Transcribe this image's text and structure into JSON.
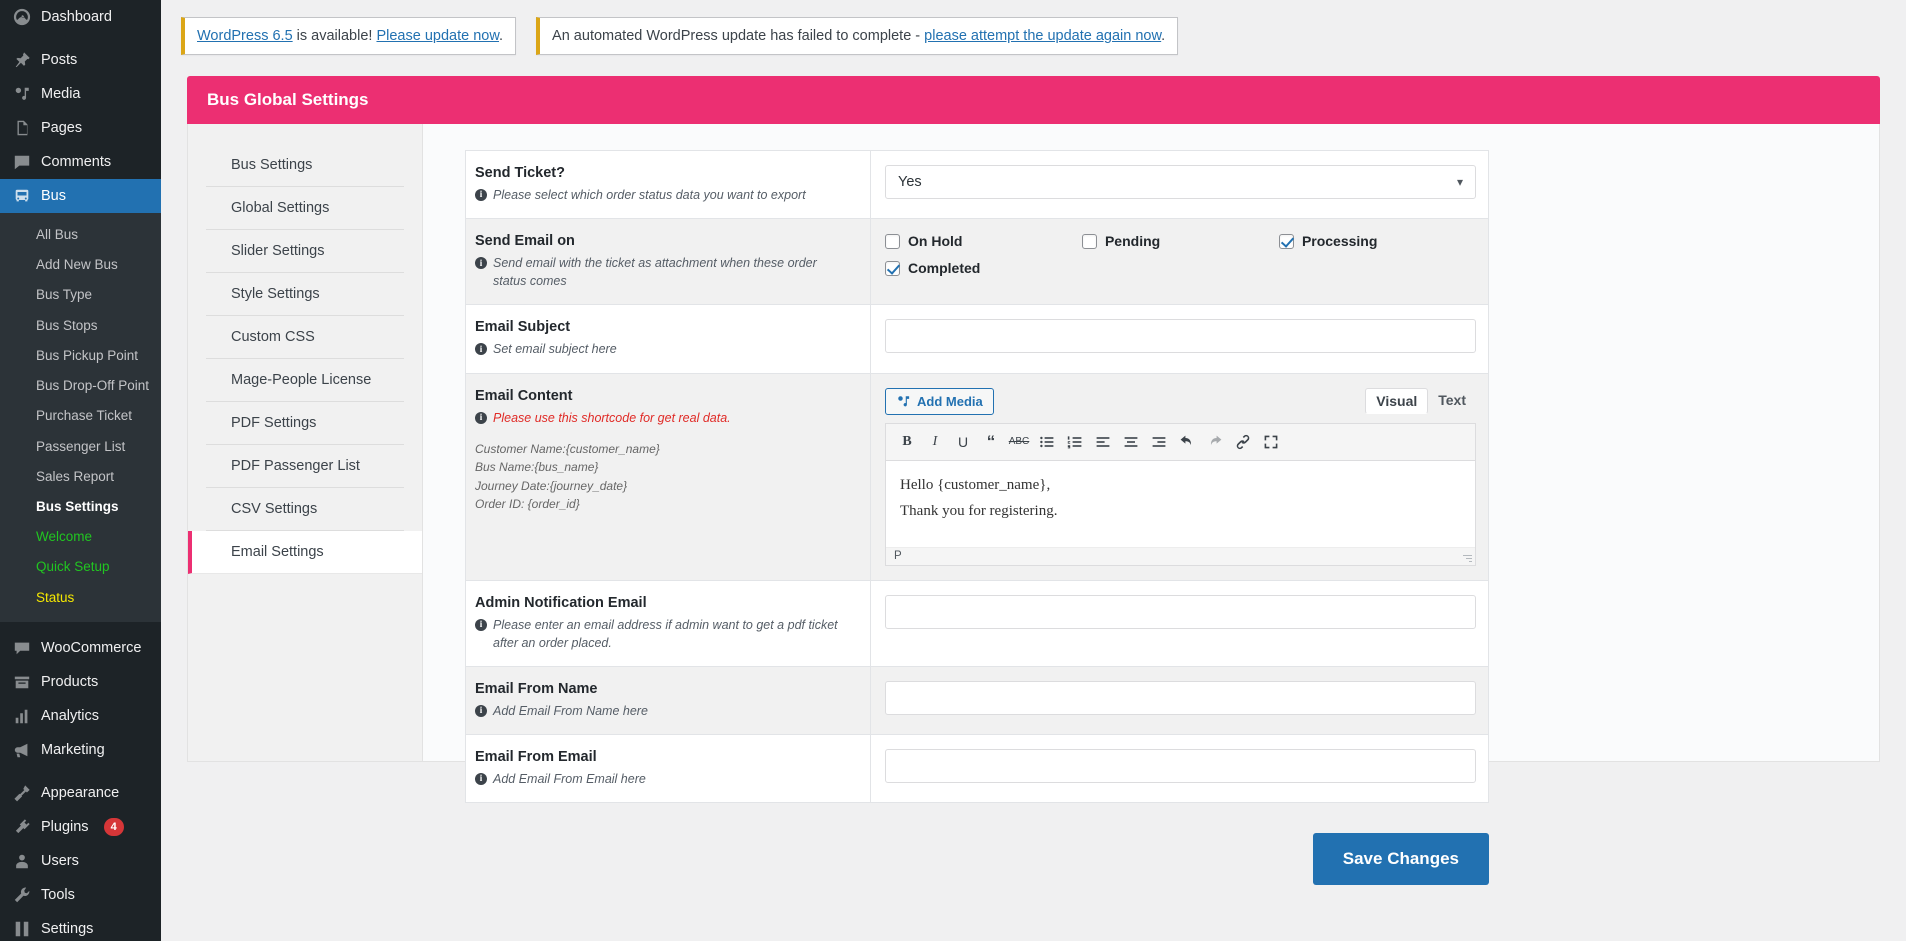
{
  "sidebar": {
    "top_items": [
      {
        "label": "Dashboard",
        "icon": "dashboard-icon"
      },
      {
        "label": "Posts",
        "icon": "pin-icon"
      },
      {
        "label": "Media",
        "icon": "media-icon"
      },
      {
        "label": "Pages",
        "icon": "pages-icon"
      },
      {
        "label": "Comments",
        "icon": "comments-icon"
      },
      {
        "label": "Bus",
        "icon": "bus-icon",
        "current": true
      }
    ],
    "bus_submenu": [
      {
        "label": "All Bus"
      },
      {
        "label": "Add New Bus"
      },
      {
        "label": "Bus Type"
      },
      {
        "label": "Bus Stops"
      },
      {
        "label": "Bus Pickup Point"
      },
      {
        "label": "Bus Drop-Off Point"
      },
      {
        "label": "Purchase Ticket"
      },
      {
        "label": "Passenger List"
      },
      {
        "label": "Sales Report"
      },
      {
        "label": "Bus Settings",
        "state": "current"
      },
      {
        "label": "Welcome",
        "state": "green"
      },
      {
        "label": "Quick Setup",
        "state": "green"
      },
      {
        "label": "Status",
        "state": "yellow"
      }
    ],
    "group2": [
      {
        "label": "WooCommerce",
        "icon": "woocommerce-icon"
      },
      {
        "label": "Products",
        "icon": "products-icon"
      },
      {
        "label": "Analytics",
        "icon": "analytics-icon"
      },
      {
        "label": "Marketing",
        "icon": "marketing-icon"
      }
    ],
    "group3": [
      {
        "label": "Appearance",
        "icon": "appearance-icon"
      },
      {
        "label": "Plugins",
        "icon": "plugins-icon",
        "badge": "4"
      },
      {
        "label": "Users",
        "icon": "users-icon"
      },
      {
        "label": "Tools",
        "icon": "tools-icon"
      },
      {
        "label": "Settings",
        "icon": "settings-icon"
      }
    ]
  },
  "notices": {
    "update": {
      "link1": "WordPress 6.5",
      "mid": " is available! ",
      "link2": "Please update now",
      "end": "."
    },
    "failed": {
      "text": "An automated WordPress update has failed to complete - ",
      "link": "please attempt the update again now",
      "end": "."
    }
  },
  "panel": {
    "title": "Bus Global Settings",
    "tabs": [
      {
        "label": "Bus Settings"
      },
      {
        "label": "Global Settings"
      },
      {
        "label": "Slider Settings"
      },
      {
        "label": "Style Settings"
      },
      {
        "label": "Custom CSS"
      },
      {
        "label": "Mage-People License"
      },
      {
        "label": "PDF Settings"
      },
      {
        "label": "PDF Passenger List"
      },
      {
        "label": "CSV Settings"
      },
      {
        "label": "Email Settings",
        "active": true
      }
    ]
  },
  "form": {
    "send_ticket": {
      "label": "Send Ticket?",
      "desc": "Please select which order status data you want to export",
      "value": "Yes"
    },
    "send_email_on": {
      "label": "Send Email on",
      "desc": "Send email with the ticket as attachment when these order status comes",
      "options": [
        {
          "label": "On Hold",
          "checked": false
        },
        {
          "label": "Pending",
          "checked": false
        },
        {
          "label": "Processing",
          "checked": true
        },
        {
          "label": "Completed",
          "checked": true
        }
      ]
    },
    "email_subject": {
      "label": "Email Subject",
      "desc": "Set email subject here",
      "value": ""
    },
    "email_content": {
      "label": "Email Content",
      "desc": "Please use this shortcode for get real data.",
      "shortcodes": [
        "Customer Name:{customer_name}",
        "Bus Name:{bus_name}",
        "Journey Date:{journey_date}",
        "Order ID: {order_id}"
      ],
      "add_media": "Add Media",
      "tab_visual": "Visual",
      "tab_text": "Text",
      "body_lines": [
        "Hello {customer_name},",
        "Thank you for registering."
      ],
      "status_path": "P"
    },
    "admin_notification": {
      "label": "Admin Notification Email",
      "desc": "Please enter an email address if admin want to get a pdf ticket after an order placed.",
      "value": ""
    },
    "from_name": {
      "label": "Email From Name",
      "desc": "Add Email From Name here",
      "value": ""
    },
    "from_email": {
      "label": "Email From Email",
      "desc": "Add Email From Email here",
      "value": ""
    },
    "save_label": "Save Changes"
  },
  "colors": {
    "accent_pink": "#ec2f72",
    "wp_blue": "#2271b1",
    "sidebar_bg": "#1d2327",
    "notice_border": "#dba617"
  }
}
